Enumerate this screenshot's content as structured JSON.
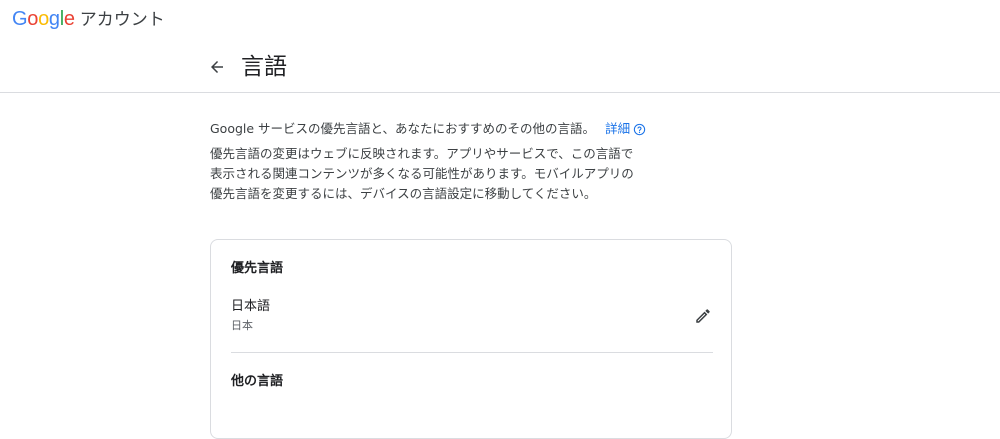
{
  "brand": {
    "logo_letters": [
      {
        "char": "G",
        "color": "#4285F4"
      },
      {
        "char": "o",
        "color": "#EA4335"
      },
      {
        "char": "o",
        "color": "#FBBC05"
      },
      {
        "char": "g",
        "color": "#4285F4"
      },
      {
        "char": "l",
        "color": "#34A853"
      },
      {
        "char": "e",
        "color": "#EA4335"
      }
    ],
    "product_name": "アカウント"
  },
  "header": {
    "back_icon": "arrow-back-icon",
    "title": "言語"
  },
  "intro": {
    "text": "Google サービスの優先言語と、あなたにおすすめのその他の言語。",
    "learn_more_label": "詳細",
    "help_icon": "help-circle-icon"
  },
  "description": {
    "lines": [
      "優先言語の変更はウェブに反映されます。アプリやサービスで、この言語で",
      "表示される関連コンテンツが多くなる可能性があります。モバイルアプリの",
      "優先言語を変更するには、デバイスの言語設定に移動してください。"
    ]
  },
  "preferred": {
    "section_title": "優先言語",
    "language": "日本語",
    "region": "日本",
    "edit_icon": "pencil-icon"
  },
  "other": {
    "section_title": "他の言語"
  },
  "colors": {
    "link": "#1a73e8",
    "divider": "#dadce0",
    "text_primary": "#202124",
    "text_secondary": "#5f6368"
  }
}
